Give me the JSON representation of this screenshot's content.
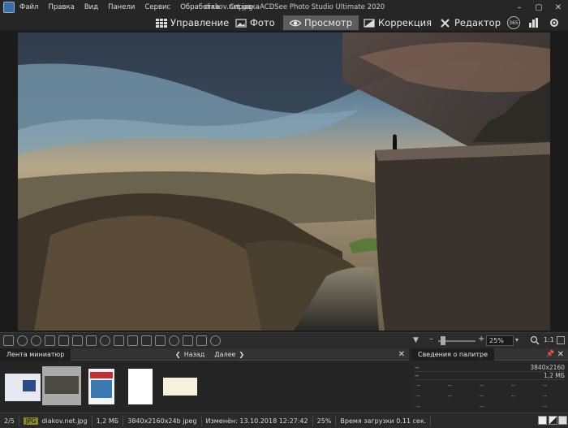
{
  "menu": [
    "Файл",
    "Правка",
    "Вид",
    "Панели",
    "Сервис",
    "Обработка",
    "Справка"
  ],
  "window_title": "diakov.net.jpg - ACDSee Photo Studio Ultimate 2020",
  "window_controls": {
    "minimize": "–",
    "maximize": "▢",
    "close": "✕"
  },
  "modes": [
    {
      "label": "Управление",
      "icon": "grid-icon"
    },
    {
      "label": "Фото",
      "icon": "photo-icon"
    },
    {
      "label": "Просмотр",
      "icon": "eye-icon",
      "active": true
    },
    {
      "label": "Коррекция",
      "icon": "adjust-icon"
    },
    {
      "label": "Редактор",
      "icon": "edit-icon"
    }
  ],
  "badge_365": "365",
  "zoom": "25%",
  "zoom_ratio": "1:1",
  "filmstrip": {
    "tab": "Лента миниатюр",
    "back": "Назад",
    "next": "Далее",
    "close": "✕"
  },
  "palette": {
    "tab": "Сведения о палитре",
    "rows": [
      [
        "--",
        "3840x2160"
      ],
      [
        "--",
        "1,2 МБ"
      ]
    ],
    "cells": [
      "--",
      "--",
      "--",
      "--",
      "--",
      "--",
      "--",
      "--",
      "--",
      "--",
      "--",
      "--",
      "--"
    ]
  },
  "status": {
    "index": "2/5",
    "format": "JPG",
    "filename": "diakov.net.jpg",
    "size": "1,2 МБ",
    "dims": "3840x2160x24b jpeg",
    "modified": "Изменён: 13.10.2018 12:27:42",
    "zoom": "25%",
    "load": "Время загрузки 0.11 сек."
  },
  "colors": {
    "accent": "#5d5d5d",
    "bg": "#1e1e1e"
  }
}
